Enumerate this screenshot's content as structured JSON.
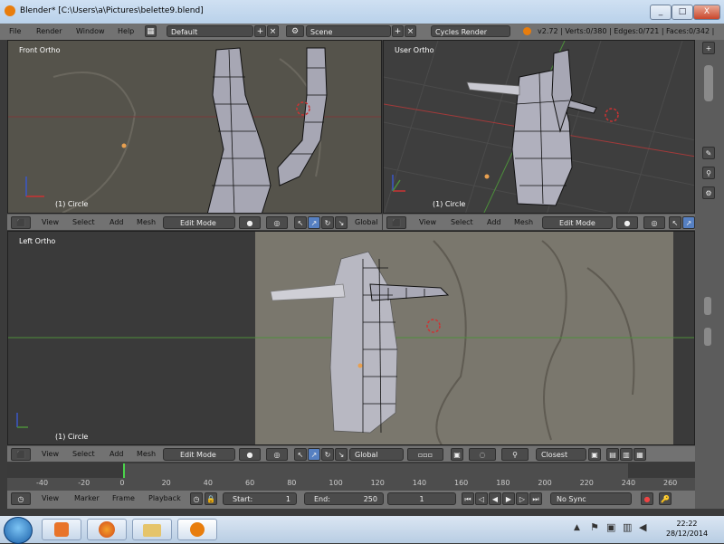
{
  "window": {
    "title": "Blender* [C:\\Users\\a\\Pictures\\belette9.blend]",
    "controls": [
      "_",
      "□",
      "X"
    ]
  },
  "info_header": {
    "menus": [
      "File",
      "Render",
      "Window",
      "Help"
    ],
    "screen_layout": "Default",
    "scene": "Scene",
    "render_engine": "Cycles Render",
    "stats": "v2.72 | Verts:0/380 | Edges:0/721 | Faces:0/342 |"
  },
  "viewports": [
    {
      "label": "Front Ortho",
      "object_label": "(1) Circle"
    },
    {
      "label": "User Ortho",
      "object_label": "(1) Circle"
    },
    {
      "label": "Left Ortho",
      "object_label": "(1) Circle"
    }
  ],
  "view_header": {
    "menus": [
      "View",
      "Select",
      "Add",
      "Mesh"
    ],
    "mode": "Edit Mode",
    "orientation": "Global",
    "snap": "Closest"
  },
  "timeline": {
    "ticks": [
      "-40",
      "-20",
      "0",
      "20",
      "40",
      "60",
      "80",
      "100",
      "120",
      "140",
      "160",
      "180",
      "200",
      "220",
      "240",
      "260"
    ],
    "current_frame_marker": 0
  },
  "timeline_header": {
    "menus": [
      "View",
      "Marker",
      "Frame",
      "Playback"
    ],
    "start_label": "Start:",
    "start_value": "1",
    "end_label": "End:",
    "end_value": "250",
    "current_frame": "1",
    "sync": "No Sync"
  },
  "taskbar": {
    "time": "22:22",
    "date": "28/12/2014"
  },
  "colors": {
    "viewport_bg": "#3d3d3d",
    "header_bg": "#727272",
    "selection_blue": "#5680c2",
    "x_axis_red": "#a33a3a",
    "y_axis_green": "#4d8f3b"
  }
}
